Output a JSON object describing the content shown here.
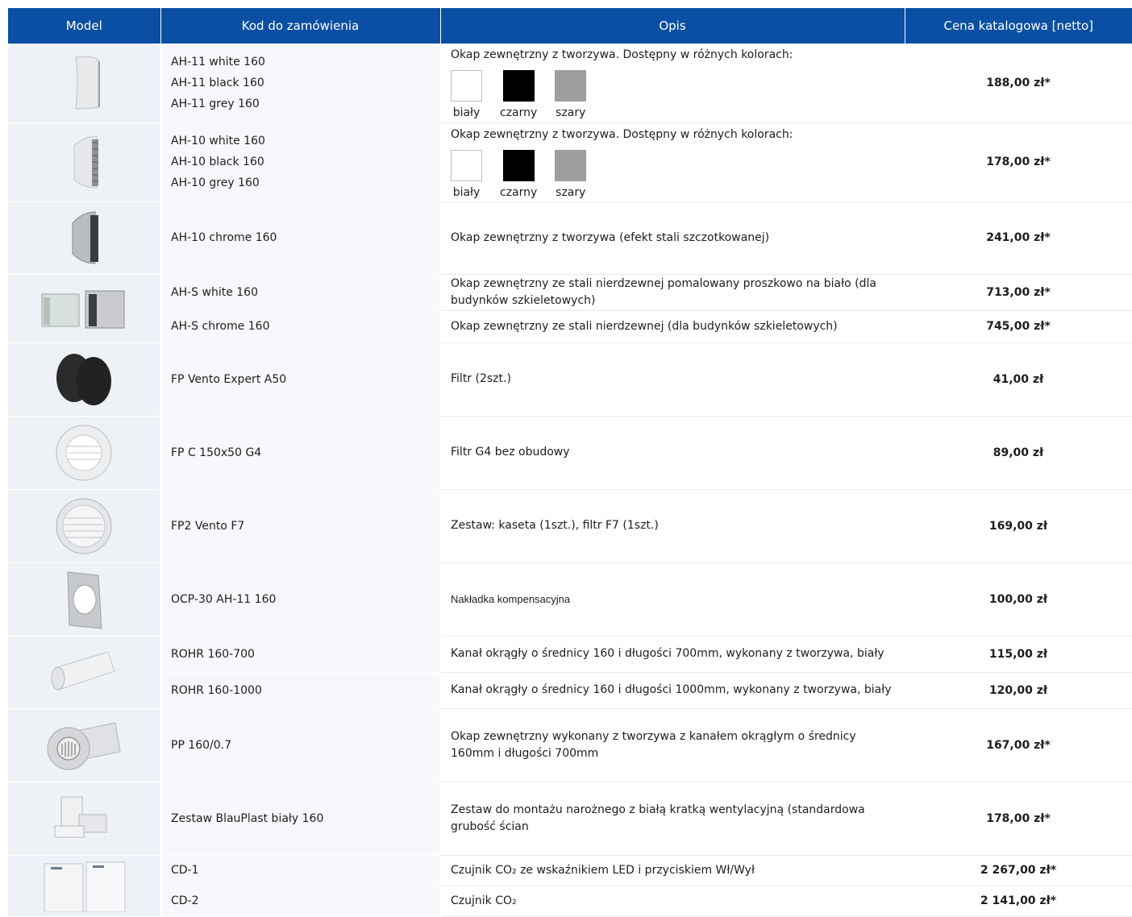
{
  "header": {
    "model": "Model",
    "code": "Kod do zamówienia",
    "desc": "Opis",
    "price": "Cena katalogowa [netto]"
  },
  "colors": {
    "header_bg": "#0a4fa3",
    "white": "#ffffff",
    "black": "#000000",
    "grey": "#9e9e9e"
  },
  "rows": {
    "ah11": {
      "codes": [
        "AH-11 white 160",
        "AH-11 black 160",
        "AH-11 grey 160"
      ],
      "desc": "Okap zewnętrzny z tworzywa. Dostępny w różnych kolorach:",
      "swatches": [
        "biały",
        "czarny",
        "szary"
      ],
      "price": "188,00 zł*"
    },
    "ah10": {
      "codes": [
        "AH-10 white 160",
        "AH-10 black 160",
        "AH-10 grey 160"
      ],
      "desc": "Okap zewnętrzny z tworzywa. Dostępny w różnych kolorach:",
      "swatches": [
        "biały",
        "czarny",
        "szary"
      ],
      "price": "178,00 zł*"
    },
    "ah10c": {
      "code": "AH-10 chrome 160",
      "desc": "Okap zewnętrzny z tworzywa (efekt stali szczotkowanej)",
      "price": "241,00 zł*"
    },
    "ahsw": {
      "code": "AH-S white 160",
      "desc": "Okap zewnętrzny ze stali nierdzewnej pomalowany proszkowo na biało (dla budynków szkieletowych)",
      "price": "713,00 zł*"
    },
    "ahsc": {
      "code": "AH-S chrome 160",
      "desc": "Okap zewnętrzny ze stali nierdzewnej  (dla budynków szkieletowych)",
      "price": "745,00 zł*"
    },
    "fpve": {
      "code": "FP Vento Expert A50",
      "desc": "Filtr (2szt.)",
      "price": "41,00 zł"
    },
    "fpc": {
      "code": "FP C 150x50 G4",
      "desc": "Filtr G4 bez obudowy",
      "price": "89,00 zł"
    },
    "fp2": {
      "code": "FP2 Vento F7",
      "desc": "Zestaw: kaseta (1szt.), filtr F7 (1szt.)",
      "price": "169,00 zł"
    },
    "ocp": {
      "code": "OCP-30 AH-11 160",
      "desc": "Nakładka kompensacyjna",
      "price": "100,00 zł"
    },
    "rohr700": {
      "code": "ROHR 160-700",
      "desc": "Kanał okrągły o średnicy 160 i długości 700mm, wykonany z tworzywa, biały",
      "price": "115,00 zł"
    },
    "rohr1000": {
      "code": "ROHR 160-1000",
      "desc": "Kanał okrągły o średnicy 160 i długości 1000mm, wykonany z tworzywa, biały",
      "price": "120,00 zł"
    },
    "pp": {
      "code": "PP 160/0.7",
      "desc": "Okap zewnętrzny wykonany z tworzywa z kanałem okrągłym o średnicy 160mm i długości 700mm",
      "price": "167,00 zł*"
    },
    "blau": {
      "code": "Zestaw BlauPlast biały 160",
      "desc": "Zestaw do montażu narożnego z białą kratką wentylacyjną (standardowa grubość ścian",
      "price": "178,00 zł*"
    },
    "cd1": {
      "code": "CD-1",
      "desc": "Czujnik CO₂ ze wskaźnikiem LED i przyciskiem Wł/Wył",
      "price": "2 267,00 zł*"
    },
    "cd2": {
      "code": "CD-2",
      "desc": "Czujnik CO₂",
      "price": "2 141,00 zł*"
    }
  }
}
